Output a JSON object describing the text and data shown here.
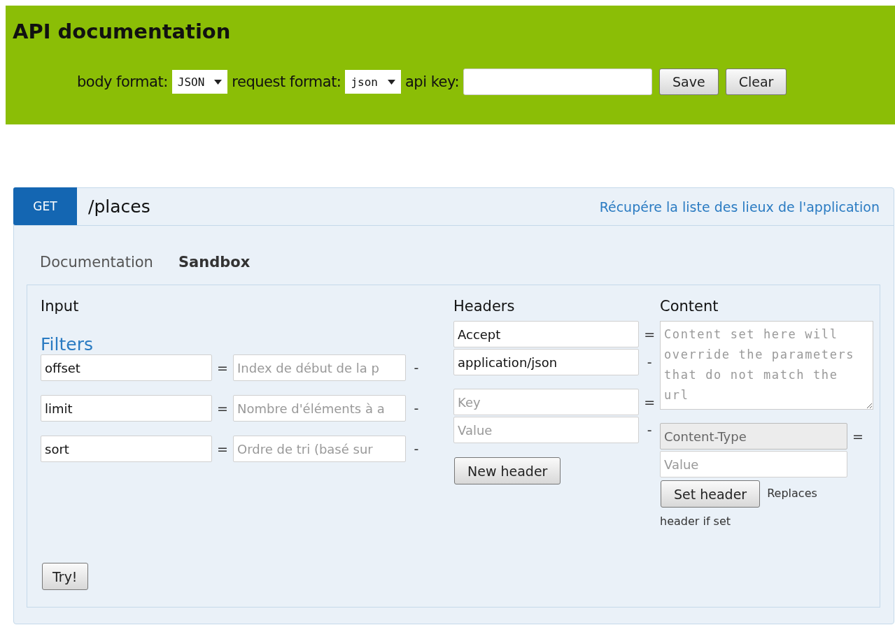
{
  "header": {
    "title": "API documentation",
    "body_format": {
      "label": "body format:",
      "value": "JSON"
    },
    "request_format": {
      "label": "request format:",
      "value": "json"
    },
    "api_key": {
      "label": "api key:"
    },
    "buttons": [
      "Save",
      "Clear"
    ]
  },
  "endpoint": {
    "method": "GET",
    "path": "/places",
    "description": "Récupére la liste des lieux de l'application",
    "tabs": [
      {
        "label": "Documentation",
        "selected": false
      },
      {
        "label": "Sandbox",
        "selected": true
      }
    ],
    "input": {
      "title": "Input",
      "filters_title": "Filters",
      "filters": [
        {
          "name": "offset",
          "separator": "=",
          "placeholder": "Index de début de la p",
          "remove": "-"
        },
        {
          "name": "limit",
          "separator": "=",
          "placeholder": "Nombre d'éléments à a",
          "remove": "-"
        },
        {
          "name": "sort",
          "separator": "=",
          "placeholder": "Ordre de tri (basé sur",
          "remove": "-"
        }
      ],
      "try_button": "Try!"
    },
    "headers": {
      "title": "Headers",
      "rows": [
        {
          "key": "Accept",
          "separator": "=",
          "value": "application/json",
          "remove": "-"
        }
      ],
      "new_row": {
        "key_placeholder": "Key",
        "separator": "=",
        "value_placeholder": "Value",
        "remove": "-"
      },
      "new_button": "New header"
    },
    "content": {
      "title": "Content",
      "placeholder": "Content set here will override the parameters that do not match the url",
      "type_field": {
        "value": "Content-Type",
        "disabled": true
      },
      "separator": "=",
      "value_placeholder": "Value",
      "set_button": "Set header",
      "note_lines": [
        "Replaces",
        "header if set"
      ]
    }
  }
}
